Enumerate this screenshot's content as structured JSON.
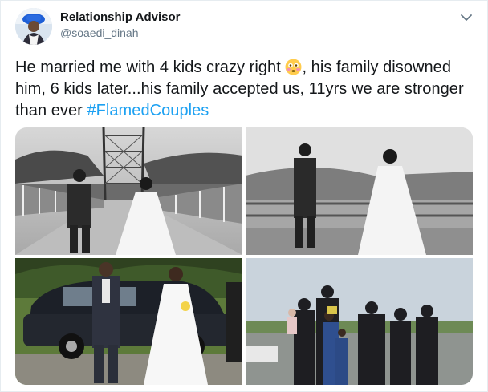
{
  "author": {
    "name": "Relationship Advisor",
    "handle": "@soaedi_dinah",
    "avatar_icon": "profile-photo"
  },
  "menu_icon": "chevron-down-icon",
  "tweet": {
    "text_before_emoji": "He married me with 4 kids crazy right ",
    "emoji": "flushed-face-emoji",
    "text_after_emoji": ", his family disowned him, 6 kids later...his family accepted us, 11yrs we are stronger than ever ",
    "hashtag": "#FlamedCouples"
  },
  "colors": {
    "link": "#1da1f2",
    "secondary_text": "#657786",
    "border": "#e6ecf0"
  },
  "media": [
    {
      "name": "wedding-photo-bridge"
    },
    {
      "name": "wedding-photo-river"
    },
    {
      "name": "wedding-photo-classic-car"
    },
    {
      "name": "family-photo"
    }
  ]
}
